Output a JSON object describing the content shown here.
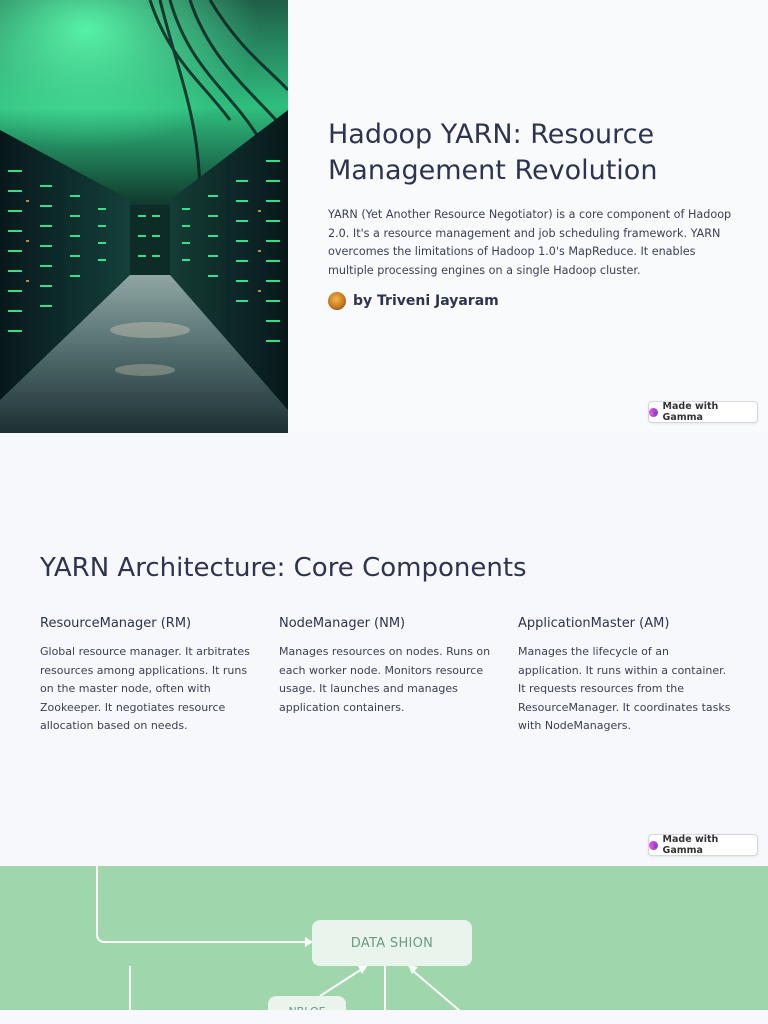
{
  "slide1": {
    "title": "Hadoop YARN: Resource Management Revolution",
    "description": "YARN (Yet Another Resource Negotiator) is a core component of Hadoop 2.0. It's a resource management and job scheduling framework. YARN overcomes the limitations of Hadoop 1.0's MapReduce. It enables multiple processing engines on a single Hadoop cluster.",
    "author": "by Triveni Jayaram",
    "badge": "Made with Gamma"
  },
  "slide2": {
    "title": "YARN Architecture: Core Components",
    "columns": [
      {
        "heading": "ResourceManager (RM)",
        "text": "Global resource manager. It arbitrates resources among applications. It runs on the master node, often with Zookeeper. It negotiates resource allocation based on needs."
      },
      {
        "heading": "NodeManager (NM)",
        "text": "Manages resources on nodes. Runs on each worker node. Monitors resource usage. It launches and manages application containers."
      },
      {
        "heading": "ApplicationMaster (AM)",
        "text": "Manages the lifecycle of an application. It runs within a container. It requests resources from the ResourceManager. It coordinates tasks with NodeManagers."
      }
    ],
    "badge": "Made with Gamma"
  },
  "slide3": {
    "box_label": "DATA SHION",
    "box2_label": "NBLOE"
  },
  "colors": {
    "accent_green": "#a0d6ab",
    "text_dark": "#2e3350",
    "server_glow": "#3dff9a"
  }
}
